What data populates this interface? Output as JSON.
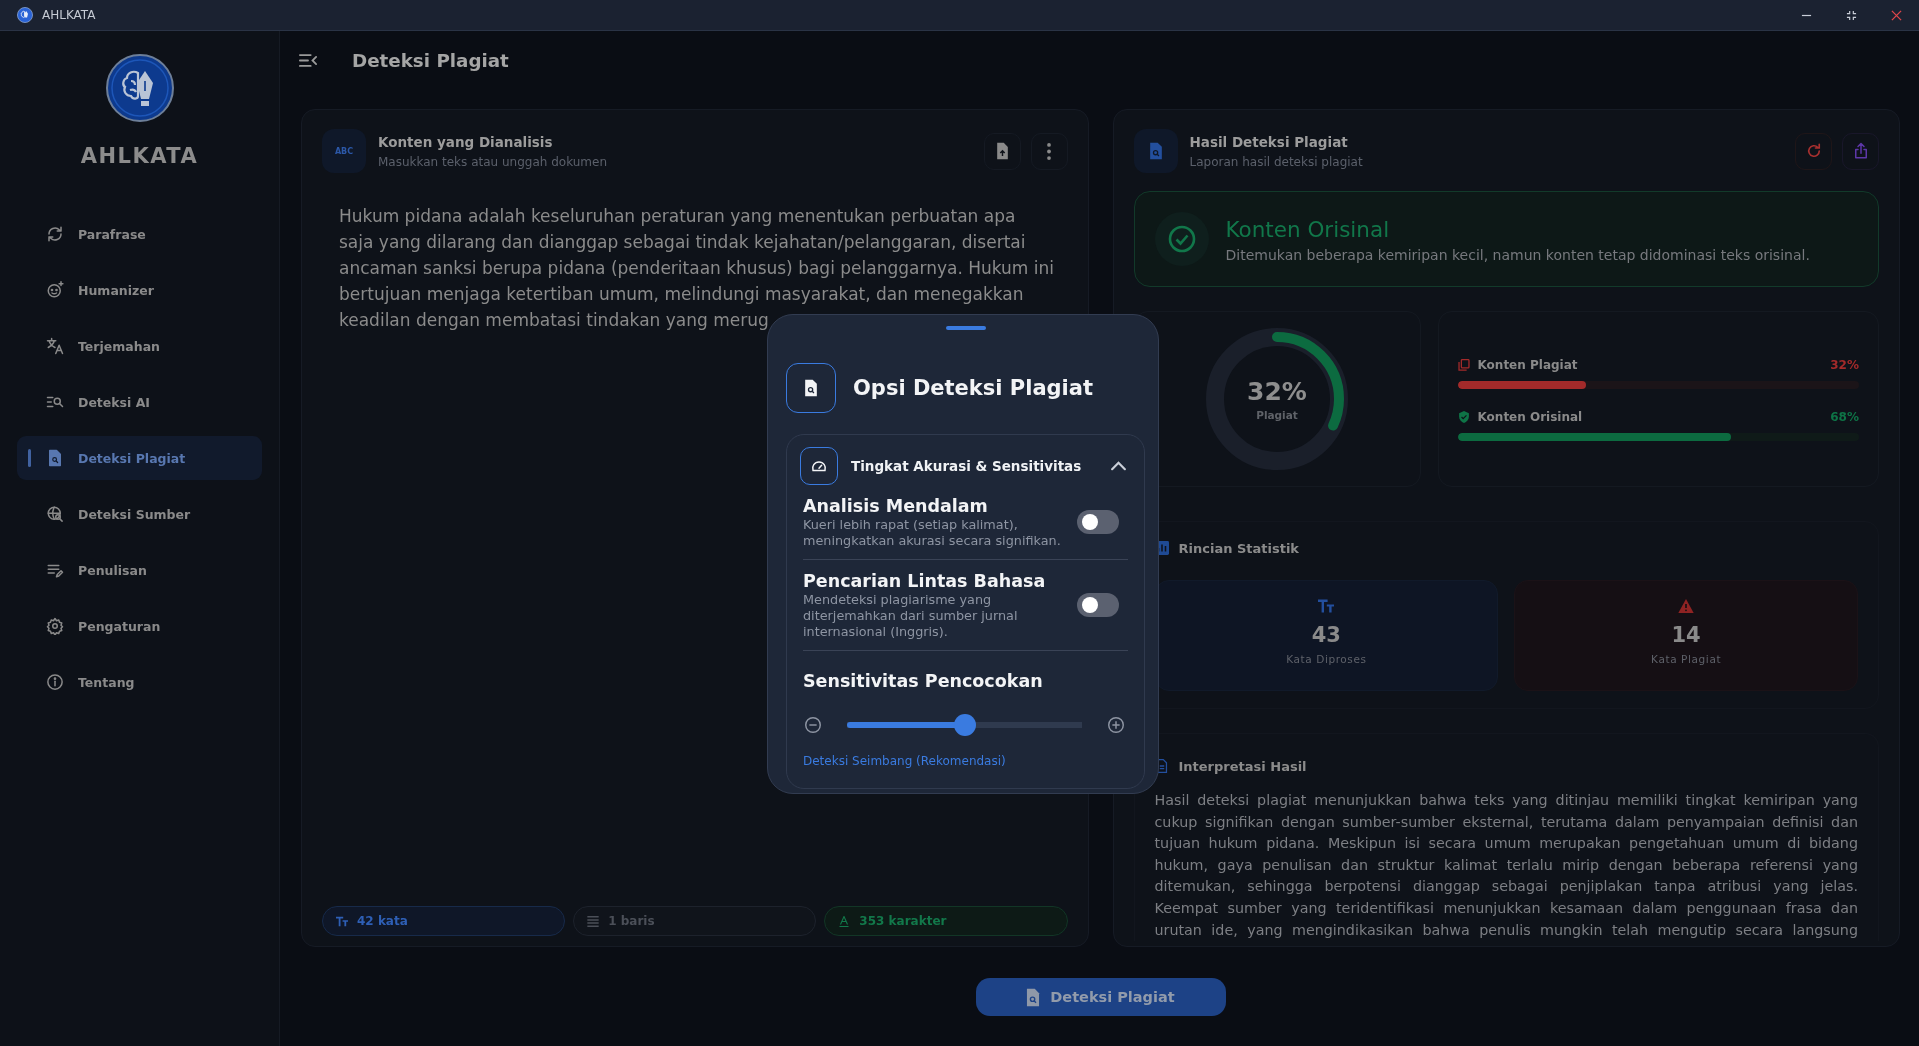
{
  "window": {
    "title": "AHLKATA"
  },
  "sidebar": {
    "brand": "AHLKATA",
    "items": [
      {
        "label": "Parafrase",
        "selected": false
      },
      {
        "label": "Humanizer",
        "selected": false
      },
      {
        "label": "Terjemahan",
        "selected": false
      },
      {
        "label": "Deteksi AI",
        "selected": false
      },
      {
        "label": "Deteksi Plagiat",
        "selected": true
      },
      {
        "label": "Deteksi Sumber",
        "selected": false
      },
      {
        "label": "Penulisan",
        "selected": false
      },
      {
        "label": "Pengaturan",
        "selected": false
      },
      {
        "label": "Tentang",
        "selected": false
      }
    ]
  },
  "header": {
    "title": "Deteksi Plagiat"
  },
  "input_panel": {
    "badge": "ABC",
    "title": "Konten yang Dianalisis",
    "subtitle": "Masukkan teks atau unggah dokumen",
    "text": "Hukum pidana adalah keseluruhan peraturan yang menentukan perbuatan apa saja yang dilarang dan dianggap sebagai tindak kejahatan/pelanggaran, disertai ancaman sanksi berupa pidana (penderitaan khusus) bagi pelanggarnya. Hukum ini bertujuan menjaga ketertiban umum, melindungi masyarakat, dan menegakkan keadilan dengan membatasi tindakan yang merug",
    "stats": [
      {
        "kind": "words",
        "text": "42 kata"
      },
      {
        "kind": "lines",
        "text": "1 baris"
      },
      {
        "kind": "chars",
        "text": "353 karakter"
      }
    ]
  },
  "result_panel": {
    "title": "Hasil Deteksi Plagiat",
    "subtitle": "Laporan hasil deteksi plagiat",
    "verdict": {
      "kind": "original",
      "title": "Konten Orisinal",
      "message": "Ditemukan beberapa kemiripan kecil, namun konten tetap didominasi teks orisinal."
    },
    "score": {
      "value": "32%",
      "label": "Plagiat",
      "level": 0.32
    },
    "breakdown": [
      {
        "kind": "plagiarized",
        "label": "Konten Plagiat",
        "value": "32%",
        "level": 0.32
      },
      {
        "kind": "original",
        "label": "Konten Orisinal",
        "value": "68%",
        "level": 0.68
      }
    ],
    "statistics": {
      "title": "Rincian Statistik",
      "cards": [
        {
          "kind": "processed",
          "value": "43",
          "label": "Kata Diproses"
        },
        {
          "kind": "plagiarized",
          "value": "14",
          "label": "Kata Plagiat"
        }
      ]
    },
    "interpretation": {
      "title": "Interpretasi Hasil",
      "text": "Hasil deteksi plagiat menunjukkan bahwa teks yang ditinjau memiliki tingkat kemiripan yang cukup signifikan dengan sumber-sumber eksternal, terutama dalam penyampaian definisi dan tujuan hukum pidana. Meskipun isi secara umum merupakan pengetahuan umum di bidang hukum, gaya penulisan dan struktur kalimat terlalu mirip dengan beberapa referensi yang ditemukan, sehingga berpotensi dianggap sebagai penjiplakan tanpa atribusi yang jelas. Keempat sumber yang teridentifikasi menunjukkan kesamaan dalam penggunaan frasa dan urutan ide, yang mengindikasikan bahwa penulis mungkin telah mengutip secara langsung"
    }
  },
  "action_button": "Deteksi Plagiat",
  "modal": {
    "title": "Opsi Deteksi Plagiat",
    "section": {
      "title": "Tingkat Akurasi & Sensitivitas",
      "expanded": true,
      "options": [
        {
          "title": "Analisis Mendalam",
          "description": "Kueri lebih rapat (setiap kalimat), meningkatkan akurasi secara signifikan.",
          "on": false
        },
        {
          "title": "Pencarian Lintas Bahasa",
          "description": "Mendeteksi plagiarisme yang diterjemahkan dari sumber jurnal internasional (Inggris).",
          "on": false
        }
      ],
      "slider": {
        "title": "Sensitivitas Pencocokan",
        "level": 0.5,
        "value_label": "Deteksi Seimbang (Rekomendasi)"
      }
    }
  }
}
